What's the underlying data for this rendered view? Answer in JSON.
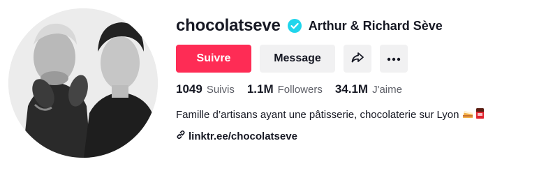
{
  "profile": {
    "username": "chocolatseve",
    "nickname": "Arthur & Richard Sève",
    "verified": true,
    "accent_color": "#fe2c55",
    "verified_color": "#20d5ec"
  },
  "actions": {
    "follow_label": "Suivre",
    "message_label": "Message",
    "share_icon": "share-arrow-icon",
    "more_icon": "more-dots-icon"
  },
  "stats": {
    "following": {
      "value": "1049",
      "label": "Suivis"
    },
    "followers": {
      "value": "1.1M",
      "label": "Followers"
    },
    "likes": {
      "value": "34.1M",
      "label": "J'aime"
    }
  },
  "bio": {
    "text": "Famille d’artisans ayant une pâtisserie, chocolaterie sur Lyon",
    "emojis": "cake-and-chocolate-emoji"
  },
  "link": {
    "icon": "link-icon",
    "text": "linktr.ee/chocolatseve"
  }
}
